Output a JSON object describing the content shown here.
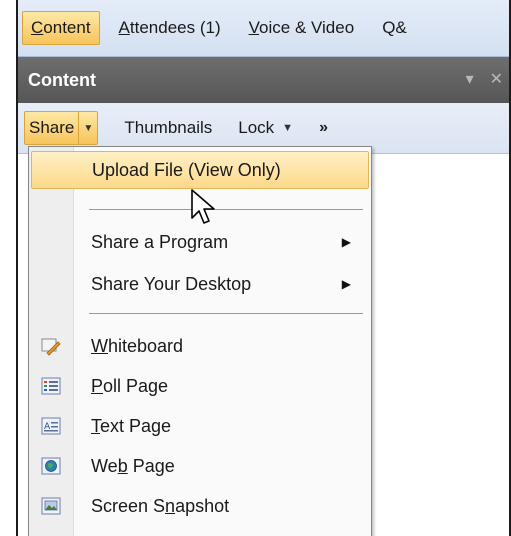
{
  "tabs": [
    {
      "label": "Content",
      "active": true
    },
    {
      "label": "Attendees (1)",
      "active": false
    },
    {
      "label": "Voice & Video",
      "active": false
    },
    {
      "label": "Q&",
      "active": false
    }
  ],
  "panel": {
    "title": "Content",
    "controls": [
      "dropdown-arrow-icon",
      "close-icon"
    ]
  },
  "toolbar": {
    "share_label": "Share",
    "thumbnails_label": "Thumbnails",
    "lock_label": "Lock",
    "more_label": "»"
  },
  "menu": {
    "items": [
      {
        "label": "Upload File (View Only)",
        "highlighted": true,
        "icon": null,
        "submenu": false
      },
      {
        "label": "Share a Program",
        "highlighted": false,
        "icon": null,
        "submenu": true
      },
      {
        "label": "Share Your Desktop",
        "highlighted": false,
        "icon": null,
        "submenu": true
      },
      {
        "label": "Whiteboard",
        "highlighted": false,
        "icon": "whiteboard-icon",
        "submenu": false
      },
      {
        "label": "Poll Page",
        "highlighted": false,
        "icon": "poll-page-icon",
        "submenu": false
      },
      {
        "label": "Text Page",
        "highlighted": false,
        "icon": "text-page-icon",
        "submenu": false
      },
      {
        "label": "Web Page",
        "highlighted": false,
        "icon": "web-page-icon",
        "submenu": false
      },
      {
        "label": "Screen Snapshot",
        "highlighted": false,
        "icon": "screen-snapshot-icon",
        "submenu": false
      }
    ]
  },
  "colors": {
    "active_tab": "#f7c45a",
    "panel_header": "#5e5e5e",
    "menu_highlight": "#fcd98a"
  }
}
